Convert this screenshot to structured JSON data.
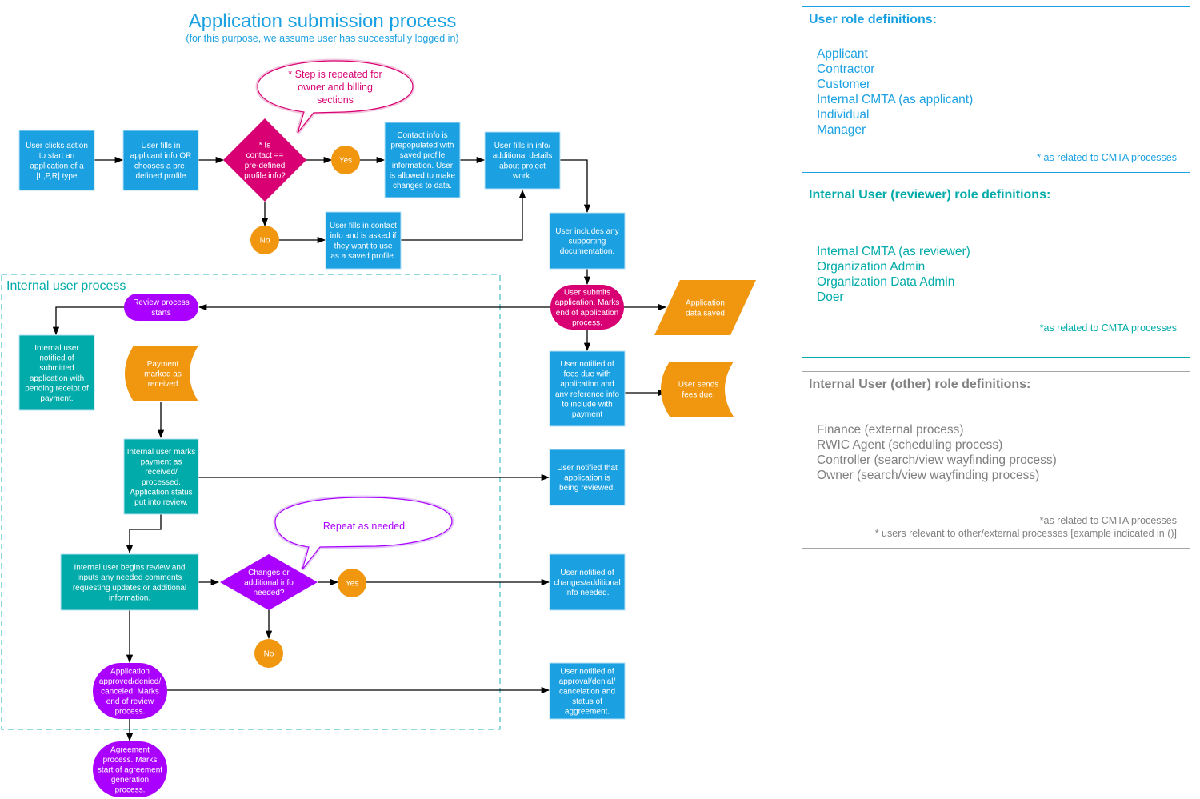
{
  "header": {
    "title": "Application submission process",
    "subtitle": "(for this purpose, we assume user has successfully logged in)"
  },
  "colors": {
    "user_step": "#1ba1e2",
    "internal_step": "#00aba9",
    "decision_main": "#d80073",
    "decision_review": "#aa00ff",
    "connector": "#f0960f",
    "data": "#f0960f"
  },
  "callouts": {
    "repeat_sections": [
      "* Step is repeated for",
      "owner and billing",
      "sections"
    ],
    "repeat_needed": [
      "Repeat as needed"
    ]
  },
  "region": {
    "label": "Internal user process"
  },
  "nodes": {
    "start": [
      "User clicks action",
      "to start an",
      "application of a",
      "[L,P,R] type"
    ],
    "fill_applicant": [
      "User fills in",
      "applicant info OR",
      "chooses a pre-",
      "defined profile"
    ],
    "decision_contact": [
      "* Is",
      "contact ==",
      "pre-defined",
      "profile info?"
    ],
    "yes1": [
      "Yes"
    ],
    "no1": [
      "No"
    ],
    "prepopulated": [
      "Contact info is",
      "prepopulated with",
      "saved profile",
      "information. User",
      "is allowed to make",
      "changes to data."
    ],
    "fill_contact": [
      "User fills in contact",
      "info and is asked if",
      "they want to use",
      "as a saved profile."
    ],
    "fill_details": [
      "User fills in info/",
      "additional details",
      "about project",
      "work."
    ],
    "supporting_docs": [
      "User includes any",
      "supporting",
      "documentation."
    ],
    "submit": [
      "User submits",
      "application. Marks",
      "end of application",
      "process."
    ],
    "data_saved": [
      "Application",
      "data saved"
    ],
    "fees_notified": [
      "User notified of",
      "fees due with",
      "application and",
      "any reference info",
      "to include with",
      "payment"
    ],
    "sends_fees": [
      "User sends",
      "fees due."
    ],
    "review_starts": [
      "Review process",
      "starts"
    ],
    "internal_notified": [
      "Internal user",
      "notified of",
      "submitted",
      "application with",
      "pending receipt of",
      "payment."
    ],
    "payment_received": [
      "Payment",
      "marked as",
      "received"
    ],
    "marks_payment": [
      "Internal user marks",
      "payment as",
      "received/",
      "processed.",
      "Application status",
      "put into review."
    ],
    "being_reviewed": [
      "User notified that",
      "application is",
      "being reviewed."
    ],
    "begins_review": [
      "Internal user begins review and",
      "inputs any needed comments",
      "requesting updates or additional",
      "information."
    ],
    "decision_changes": [
      "Changes or",
      "additional info",
      "needed?"
    ],
    "yes2": [
      "Yes"
    ],
    "no2": [
      "No"
    ],
    "changes_notified": [
      "User notified of",
      "changes/additional",
      "info needed."
    ],
    "approved": [
      "Application",
      "approved/denied/",
      "canceled. Marks",
      "end of review",
      "process."
    ],
    "approval_notified": [
      "User notified of",
      "approval/denial/",
      "cancelation and",
      "status of",
      "aggreement."
    ],
    "agreement": [
      "Agreement",
      "process. Marks",
      "start of agreement",
      "generation",
      "process."
    ]
  },
  "panels": {
    "user_roles": {
      "heading": "User role definitions:",
      "items": [
        "Applicant",
        "Contractor",
        "Customer",
        "Internal CMTA (as applicant)",
        "Individual",
        "Manager"
      ],
      "footnotes": [
        "* as related to CMTA processes"
      ]
    },
    "reviewer_roles": {
      "heading": "Internal User (reviewer) role definitions:",
      "items": [
        "Internal CMTA (as reviewer)",
        "Organization Admin",
        "Organization Data Admin",
        "Doer"
      ],
      "footnotes": [
        "*as related to CMTA processes"
      ]
    },
    "other_roles": {
      "heading": "Internal User (other) role definitions:",
      "items": [
        "Finance (external process)",
        "RWIC Agent (scheduling process)",
        "Controller (search/view wayfinding process)",
        "Owner (search/view wayfinding process)"
      ],
      "footnotes": [
        "*as related to CMTA processes",
        "* users relevant to other/external processes [example indicated in ()]"
      ]
    }
  }
}
